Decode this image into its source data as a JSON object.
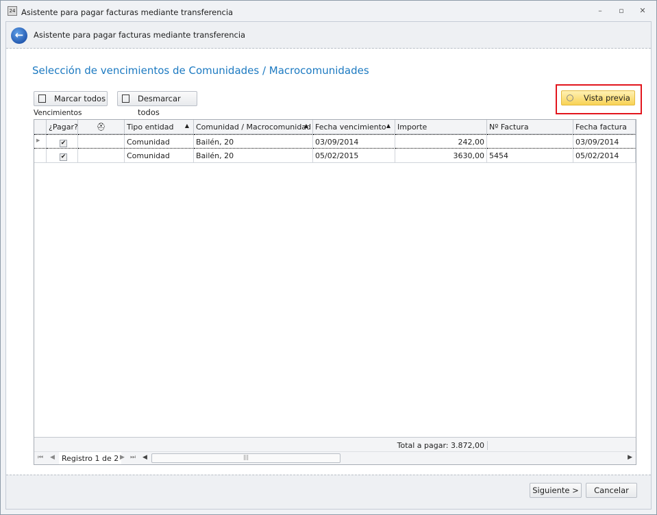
{
  "window": {
    "title": "Asistente para pagar facturas mediante transferencia",
    "minimize": "–",
    "restore": "▫",
    "close": "✕",
    "app_icon": "24"
  },
  "header": {
    "title": "Asistente para pagar facturas mediante transferencia"
  },
  "section_title": "Selección de vencimientos de Comunidades / Macrocomunidades",
  "toolbar": {
    "mark_all": "Marcar todos",
    "unmark_all": "Desmarcar todos",
    "preview": "Vista previa"
  },
  "grid_label": "Vencimientos",
  "columns": [
    "¿Pagar?",
    "",
    "Tipo entidad",
    "Comunidad / Macrocomunidad",
    "Fecha vencimiento",
    "Importe",
    "Nº Factura",
    "Fecha factura"
  ],
  "rows": [
    {
      "pagar": "✔",
      "tipo": "Comunidad",
      "comunidad": "Bailén, 20",
      "fecha_venc": "03/09/2014",
      "importe": "242,00",
      "factura": "",
      "fecha_factura": "03/09/2014"
    },
    {
      "pagar": "✔",
      "tipo": "Comunidad",
      "comunidad": "Bailén, 20",
      "fecha_venc": "05/02/2015",
      "importe": "3630,00",
      "factura": "5454",
      "fecha_factura": "05/02/2014"
    }
  ],
  "total": "Total a pagar: 3.872,00",
  "navigator": {
    "record": "Registro 1 de 2"
  },
  "buttons": {
    "next": "Siguiente >",
    "cancel": "Cancelar"
  }
}
